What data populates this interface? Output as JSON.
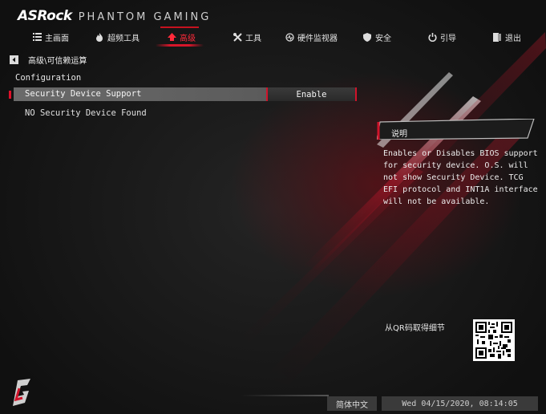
{
  "brand": {
    "name": "ASRock",
    "subtitle": "PHANTOM GAMING"
  },
  "nav": {
    "tabs": [
      {
        "label": "主画面",
        "icon": "list-icon"
      },
      {
        "label": "超频工具",
        "icon": "flame-icon"
      },
      {
        "label": "高级",
        "icon": "advanced-icon",
        "active": true
      },
      {
        "label": "工具",
        "icon": "tools-icon"
      },
      {
        "label": "硬件监视器",
        "icon": "monitor-icon"
      },
      {
        "label": "安全",
        "icon": "shield-icon"
      },
      {
        "label": "引导",
        "icon": "power-icon"
      },
      {
        "label": "退出",
        "icon": "exit-icon"
      }
    ]
  },
  "breadcrumb": {
    "path": "高级\\可信赖运算"
  },
  "section": {
    "title": "Configuration"
  },
  "settings": {
    "security_device_support": {
      "label": "Security Device Support",
      "value": "Enable"
    },
    "status": {
      "label": "NO Security Device Found"
    }
  },
  "help": {
    "title": "说明",
    "text": "Enables or Disables BIOS support for security device. O.S. will not show Security Device. TCG EFI protocol and INT1A interface will not be available."
  },
  "qr": {
    "label": "从QR码取得细节"
  },
  "footer": {
    "language": "简体中文",
    "datetime": "Wed 04/15/2020, 08:14:05"
  },
  "colors": {
    "accent": "#d0132a",
    "highlight_row": "#626262",
    "panel": "#3a3a3a"
  }
}
